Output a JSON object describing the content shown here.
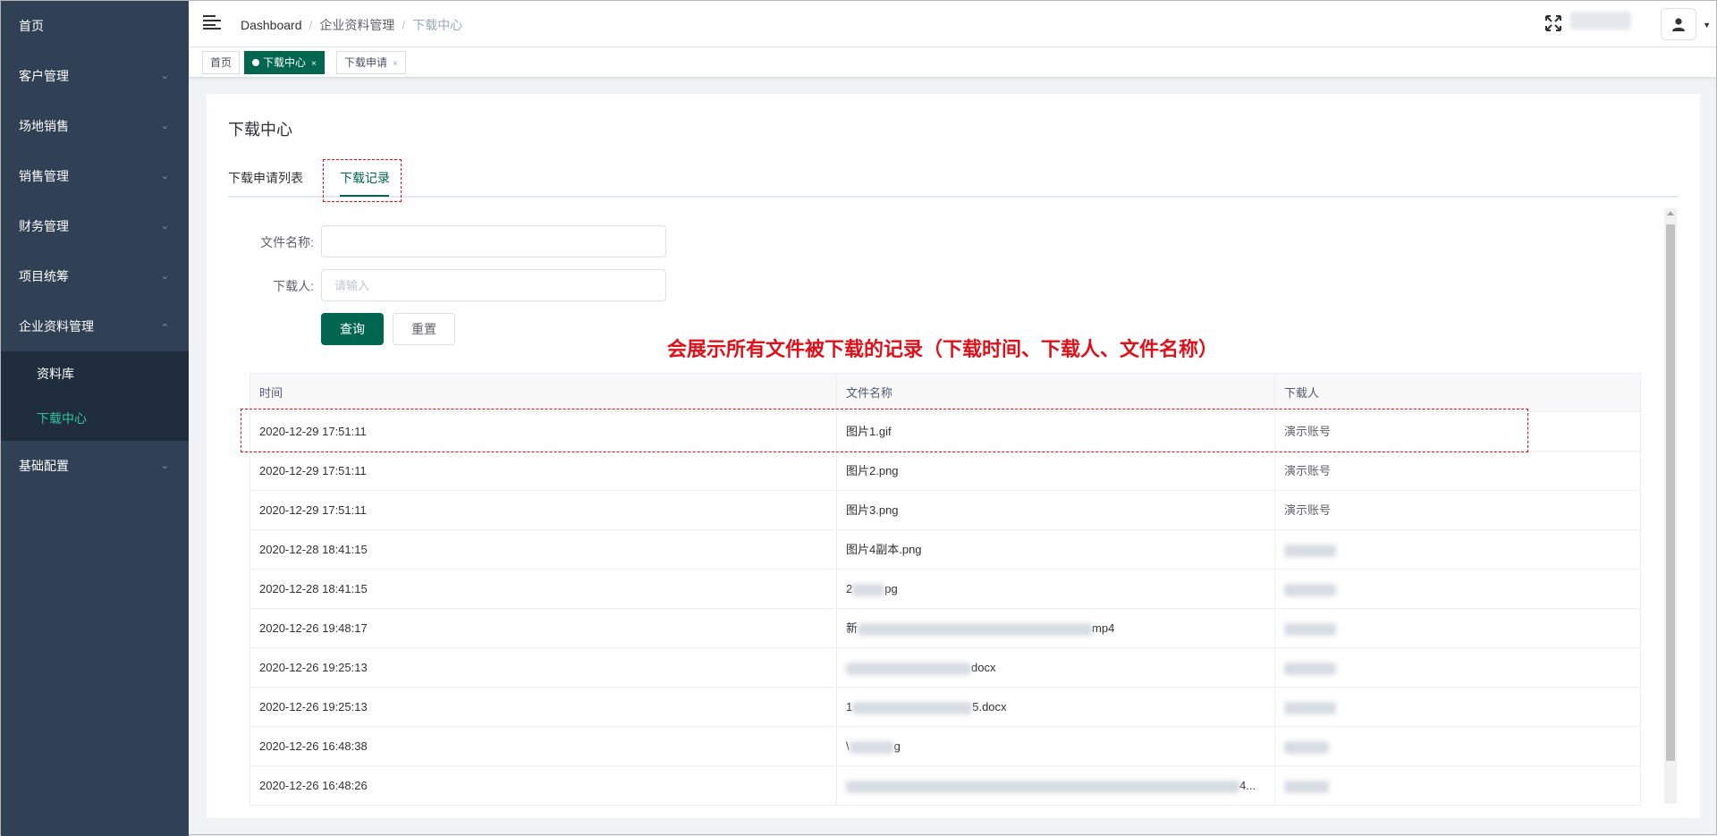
{
  "sidebar": {
    "items": [
      {
        "label": "首页",
        "chevron": false
      },
      {
        "label": "客户管理",
        "chevron": true
      },
      {
        "label": "场地销售",
        "chevron": true
      },
      {
        "label": "销售管理",
        "chevron": true
      },
      {
        "label": "财务管理",
        "chevron": true
      },
      {
        "label": "项目统筹",
        "chevron": true
      },
      {
        "label": "企业资料管理",
        "chevron": true,
        "expanded": true
      },
      {
        "label": "基础配置",
        "chevron": true
      }
    ],
    "submenu": [
      {
        "label": "资料库"
      },
      {
        "label": "下载中心",
        "active": true
      }
    ]
  },
  "header": {
    "breadcrumb": [
      "Dashboard",
      "企业资料管理",
      "下载中心"
    ]
  },
  "tags": [
    {
      "label": "首页"
    },
    {
      "label": "下载中心",
      "active": true,
      "close": "×"
    },
    {
      "label": "下载申请",
      "close": "×"
    }
  ],
  "page": {
    "title": "下载中心",
    "tabs": [
      {
        "label": "下载申请列表"
      },
      {
        "label": "下载记录",
        "active": true
      }
    ]
  },
  "form": {
    "file_name_label": "文件名称:",
    "file_name_value": "",
    "downloader_label": "下载人:",
    "downloader_placeholder": "请输入",
    "query_button": "查询",
    "reset_button": "重置"
  },
  "annotation": {
    "text": "会展示所有文件被下载的记录（下载时间、下载人、文件名称）"
  },
  "table": {
    "headers": [
      "时间",
      "文件名称",
      "下载人"
    ],
    "rows": [
      {
        "time": "2020-12-29 17:51:11",
        "file": "图片1.gif",
        "user": "演示账号"
      },
      {
        "time": "2020-12-29 17:51:11",
        "file": "图片2.png",
        "user": "演示账号"
      },
      {
        "time": "2020-12-29 17:51:11",
        "file": "图片3.png",
        "user": "演示账号"
      },
      {
        "time": "2020-12-28 18:41:15",
        "file": "图片4副本.png",
        "user": ""
      },
      {
        "time": "2020-12-28 18:41:15",
        "file_pre": "2",
        "file_post": "pg",
        "user": ""
      },
      {
        "time": "2020-12-26 19:48:17",
        "file_pre": "新",
        "file_post": "mp4",
        "user": ""
      },
      {
        "time": "2020-12-26 19:25:13",
        "file_pre": "",
        "file_post": "docx",
        "user": ""
      },
      {
        "time": "2020-12-26 19:25:13",
        "file_pre": "1",
        "file_post": "5.docx",
        "user": ""
      },
      {
        "time": "2020-12-26 16:48:38",
        "file_pre": "\\",
        "file_post": "g",
        "user": ""
      },
      {
        "time": "2020-12-26 16:48:26",
        "file_pre": "",
        "file_post": "4...",
        "user": ""
      }
    ]
  },
  "colors": {
    "sidebar_bg": "#304156",
    "submenu_bg": "#1f2d3d",
    "accent": "#006650",
    "annotation": "#e0101a"
  },
  "icons": [
    "hamburger-icon",
    "fullscreen-icon",
    "user-icon",
    "caret-down-icon",
    "chevron-down-icon",
    "chevron-up-icon",
    "close-icon"
  ]
}
